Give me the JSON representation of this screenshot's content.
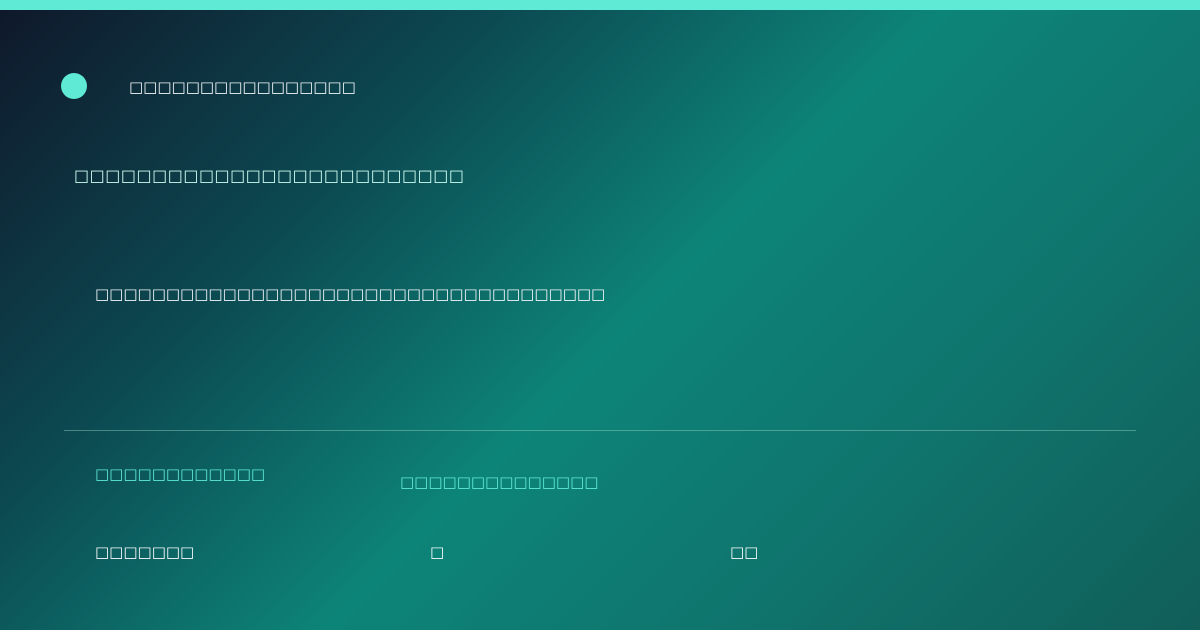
{
  "colors": {
    "accent": "#5eead4",
    "text": "#f1f5f9",
    "label": "#5eead4"
  },
  "brand": {
    "name": "□□□□□□□□□□□□□□□□"
  },
  "headline": "□□□□□□□□□□□□□□□□□□□□□□□□□",
  "subline": "□□□□□□□□□□□□□□□□□□□□□□□□□□□□□□□□□□□□",
  "footer": {
    "label_left": "□□□□□□□□□□□□",
    "label_mid": "□□□□□□□□□□□□□□",
    "value_1": "□□□□□□□",
    "value_2": "□",
    "value_3": "□□"
  }
}
